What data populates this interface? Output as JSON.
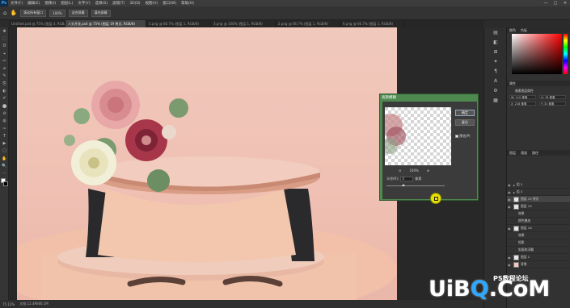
{
  "menubar": {
    "logo": "Ps",
    "items": [
      "文件(F)",
      "编辑(E)",
      "图像(I)",
      "图层(L)",
      "文字(Y)",
      "选择(S)",
      "滤镜(T)",
      "3D(D)",
      "视图(V)",
      "窗口(W)",
      "帮助(H)"
    ],
    "controls": [
      "—",
      "□",
      "✕"
    ]
  },
  "options_bar": {
    "btn1": "滚动所有窗口",
    "zoom": "100%",
    "btn2": "适合屏幕",
    "btn3": "填充屏幕"
  },
  "tabs": [
    {
      "label": "Untitled.psd @ 75% (图层 4, RGB/8)",
      "active": false
    },
    {
      "label": "人头开花.psd @ 75% (图层 19 拷贝, RGB/8)",
      "active": true
    },
    {
      "label": "5.png @ 66.7% (图层 1, RGB/8)",
      "active": false
    },
    {
      "label": "3.png @ 100% (图层 1, RGB/8)",
      "active": false
    },
    {
      "label": "2.png @ 66.7% (图层 1, RGB/8)",
      "active": false
    },
    {
      "label": "6.png @ 66.7% (图层 1, RGB/8)",
      "active": false
    }
  ],
  "tools": [
    "✥",
    "⬚",
    "ʘ",
    "⌖",
    "✂",
    "⌀",
    "✎",
    "⎘",
    "◐",
    "✐",
    "⬤",
    "⊘",
    "◍",
    "✑",
    "T",
    "▶",
    "▢",
    "✋",
    "🔍",
    "⋯"
  ],
  "status": {
    "zoom": "75.13%",
    "doc": "文档:12.4M/80.1M"
  },
  "strip_icons": [
    "▤",
    "◧",
    "⊞",
    "✦",
    "¶",
    "A",
    "⚙",
    "▦"
  ],
  "color_panel": {
    "tabs": [
      "颜色",
      "色板"
    ]
  },
  "props_panel": {
    "title": "属性",
    "subtitle": "像素图层属性",
    "w": "W: 110 像素",
    "h": "H: 76 像素",
    "x": "X: 218 像素",
    "y": "Y: 31 像素"
  },
  "layers_panel": {
    "tabs": [
      "图层",
      "通道",
      "路径"
    ],
    "rows": [
      {
        "name": "组 2",
        "selected": false
      },
      {
        "name": "组 3",
        "selected": false
      },
      {
        "name": "图层 19 拷贝",
        "selected": true
      },
      {
        "name": "图层 19",
        "selected": false
      },
      {
        "name": "效果",
        "selected": false
      },
      {
        "name": "颜色叠加",
        "selected": false
      },
      {
        "name": "图层 18",
        "selected": false
      },
      {
        "name": "效果",
        "selected": false
      },
      {
        "name": "投影",
        "selected": false
      },
      {
        "name": "斜面和浮雕",
        "selected": false
      },
      {
        "name": "图层 2",
        "selected": false
      },
      {
        "name": "背景",
        "selected": false
      }
    ]
  },
  "dialog": {
    "title": "高斯模糊",
    "ok": "确定",
    "reset": "复位",
    "preview": "预览(P)",
    "zoom": "100%",
    "radius_label": "半径(R):",
    "radius_value": "3",
    "radius_unit": "像素"
  },
  "watermark": {
    "text_a": "UiB",
    "text_q": "Q",
    "text_b": ".CoM",
    "sub": "PS教程论坛"
  },
  "colors": {
    "canvas_bg": "#f0c9bc",
    "dialog_frame": "#4e8a4f",
    "accent": "#31a8ff"
  }
}
